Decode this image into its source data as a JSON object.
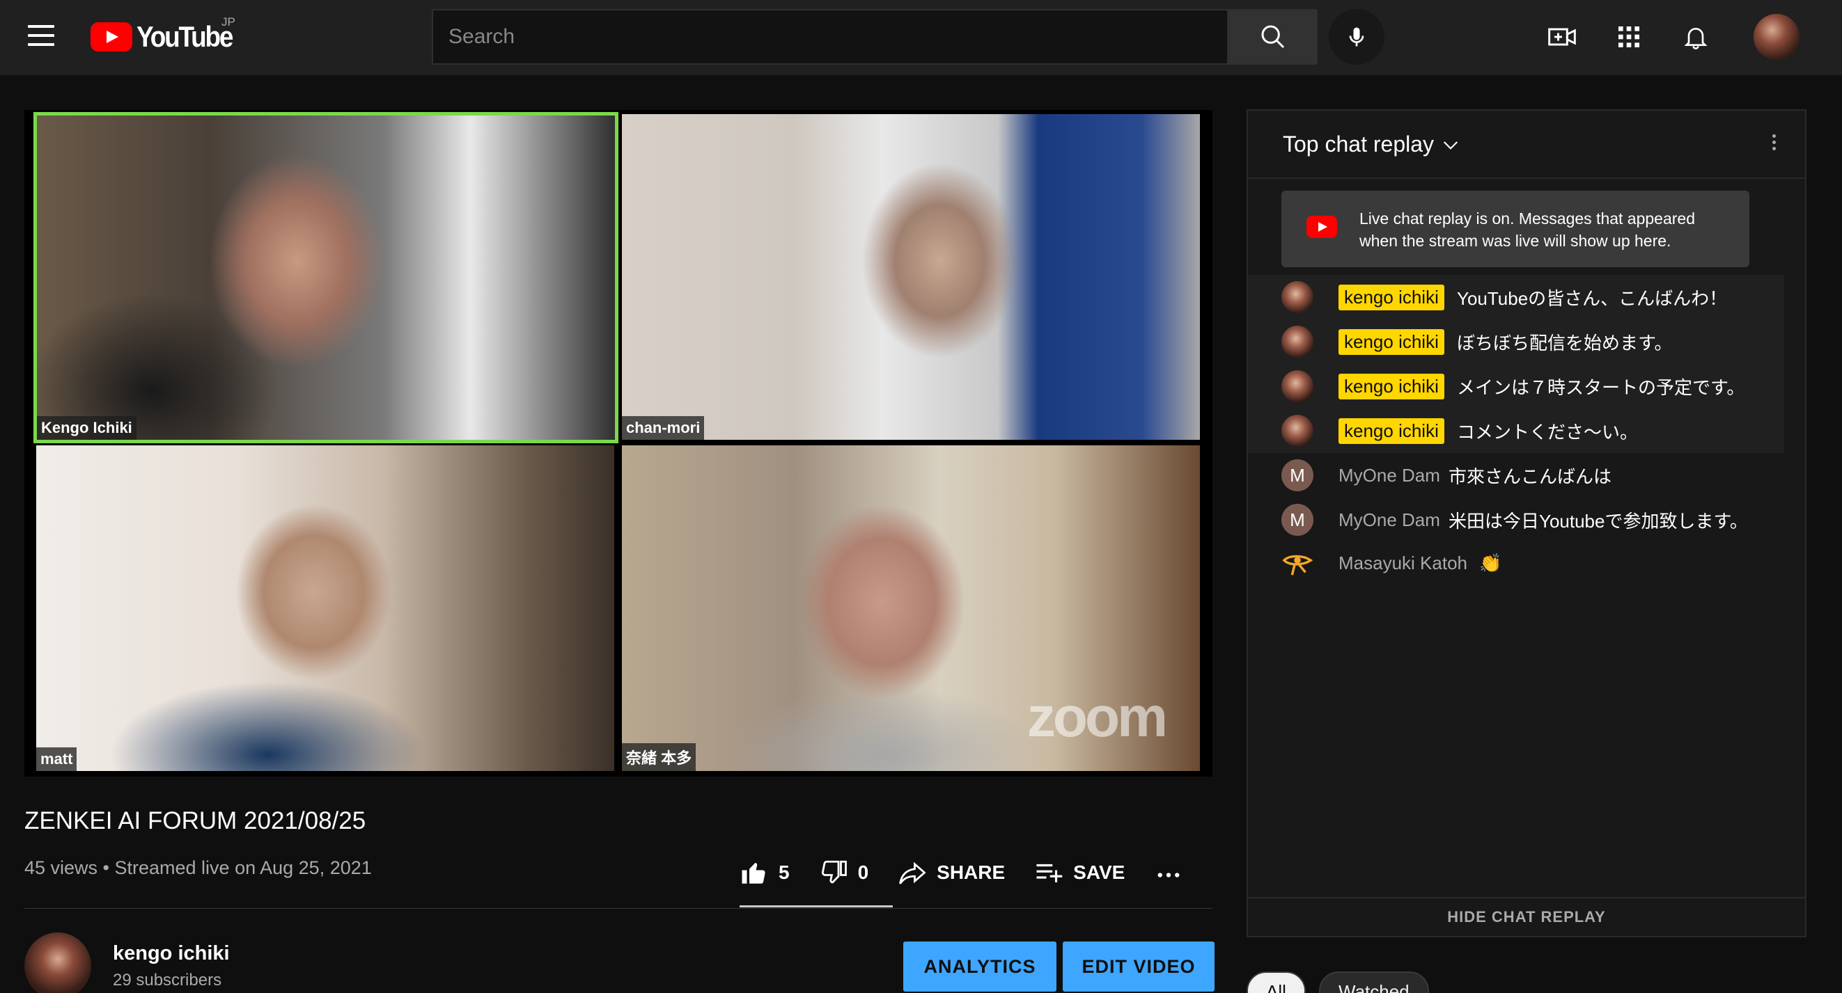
{
  "header": {
    "logo_text": "YouTube",
    "logo_region": "JP",
    "search_placeholder": "Search"
  },
  "icons": [
    "menu-icon",
    "search-icon",
    "mic-icon",
    "create-video-icon",
    "apps-icon",
    "bell-icon",
    "thumb-up-icon",
    "thumb-down-icon",
    "share-icon",
    "save-playlist-icon",
    "more-horiz-icon",
    "chevron-down-icon",
    "more-vert-icon"
  ],
  "video": {
    "tiles": [
      {
        "name": "Kengo Ichiki",
        "active_speaker": true
      },
      {
        "name": "chan-mori"
      },
      {
        "name": "matt"
      },
      {
        "name": "奈緒 本多"
      }
    ],
    "watermark": "zoom",
    "title": "ZENKEI AI FORUM 2021/08/25",
    "meta": "45 views • Streamed live on Aug 25, 2021",
    "likes": "5",
    "dislikes": "0",
    "share_label": "SHARE",
    "save_label": "SAVE"
  },
  "channel": {
    "name": "kengo ichiki",
    "subscribers": "29 subscribers",
    "analytics_label": "ANALYTICS",
    "edit_label": "EDIT VIDEO"
  },
  "chat": {
    "title": "Top chat replay",
    "notice": "Live chat replay is on. Messages that appeared when the stream was live will show up here.",
    "messages": [
      {
        "author": "kengo ichiki",
        "owner": true,
        "text": "YouTubeの皆さん、こんばんわ！"
      },
      {
        "author": "kengo ichiki",
        "owner": true,
        "text": "ぼちぼち配信を始めます。"
      },
      {
        "author": "kengo ichiki",
        "owner": true,
        "text": "メインは７時スタートの予定です。"
      },
      {
        "author": "kengo ichiki",
        "owner": true,
        "text": "コメントくださ〜い。"
      },
      {
        "author": "MyOne Dam",
        "owner": false,
        "avatar_letter": "M",
        "text": "市來さんこんばんは"
      },
      {
        "author": "MyOne Dam",
        "owner": false,
        "avatar_letter": "M",
        "text": "米田は今日Youtubeで参加致します。"
      },
      {
        "author": "Masayuki Katoh",
        "owner": false,
        "text": "👏"
      }
    ],
    "footer_label": "HIDE CHAT REPLAY"
  },
  "chips": [
    "All",
    "Watched"
  ],
  "colors": {
    "accent_blue": "#3ea6ff",
    "owner_badge": "#ffd600",
    "brand_red": "#ff0000",
    "active_speaker": "#7ad94a"
  }
}
